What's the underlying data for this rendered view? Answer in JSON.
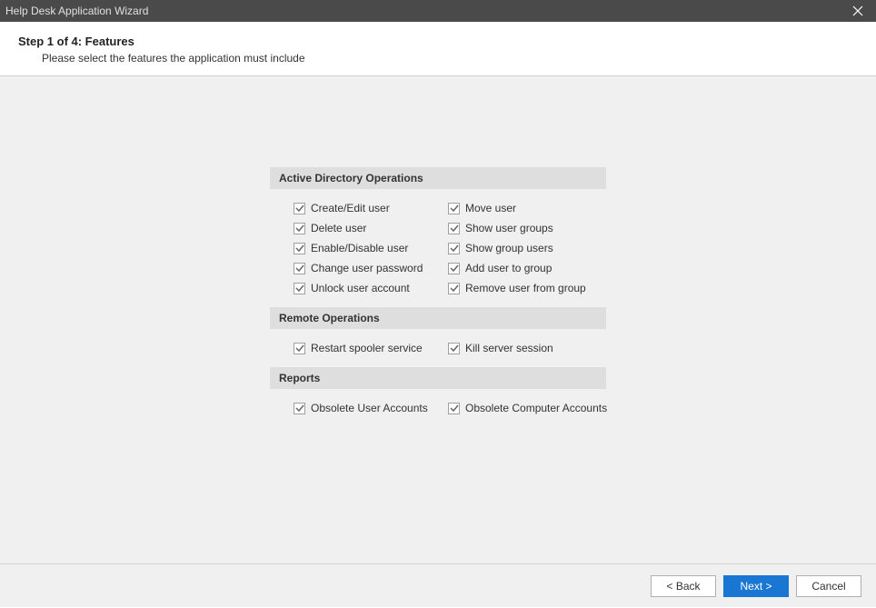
{
  "window": {
    "title": "Help Desk Application Wizard"
  },
  "header": {
    "step_title": "Step 1 of 4: Features",
    "subtitle": "Please select the features the application must include"
  },
  "sections": {
    "ad": {
      "title": "Active Directory Operations",
      "items": [
        {
          "label": "Create/Edit user",
          "checked": true
        },
        {
          "label": "Move user",
          "checked": true
        },
        {
          "label": "Delete user",
          "checked": true
        },
        {
          "label": "Show user groups",
          "checked": true
        },
        {
          "label": "Enable/Disable user",
          "checked": true
        },
        {
          "label": "Show group users",
          "checked": true
        },
        {
          "label": "Change user password",
          "checked": true
        },
        {
          "label": "Add user to group",
          "checked": true
        },
        {
          "label": "Unlock user account",
          "checked": true
        },
        {
          "label": "Remove user from group",
          "checked": true
        }
      ]
    },
    "remote": {
      "title": "Remote Operations",
      "items": [
        {
          "label": "Restart spooler service",
          "checked": true
        },
        {
          "label": "Kill server session",
          "checked": true
        }
      ]
    },
    "reports": {
      "title": "Reports",
      "items": [
        {
          "label": "Obsolete User Accounts",
          "checked": true
        },
        {
          "label": "Obsolete Computer Accounts",
          "checked": true
        }
      ]
    }
  },
  "footer": {
    "back": "< Back",
    "next": "Next >",
    "cancel": "Cancel"
  }
}
